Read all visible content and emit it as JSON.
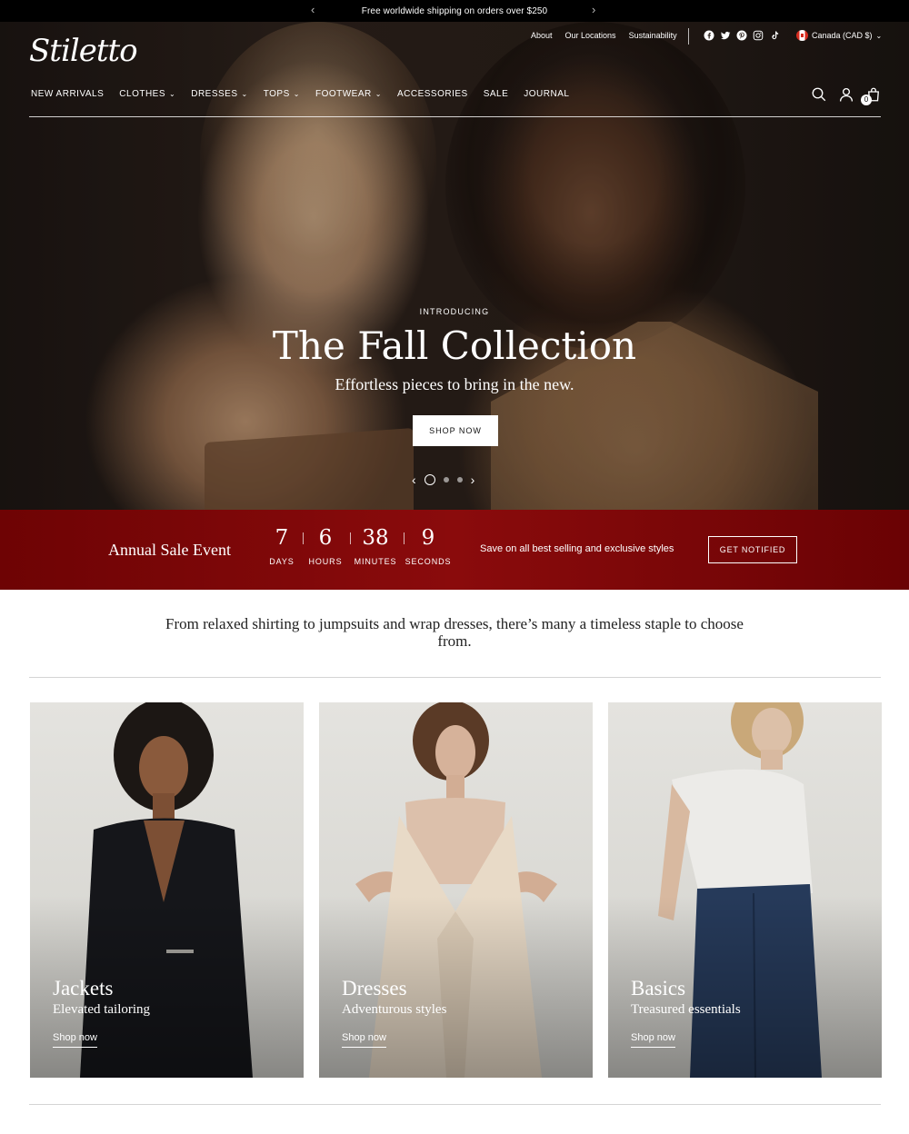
{
  "announcement": {
    "text": "Free worldwide shipping on orders over $250"
  },
  "brand": {
    "logo_text": "Stiletto"
  },
  "utility_nav": [
    "About",
    "Our Locations",
    "Sustainability"
  ],
  "social_icons": [
    "facebook-icon",
    "twitter-icon",
    "pinterest-icon",
    "instagram-icon",
    "tiktok-icon"
  ],
  "currency": {
    "label": "Canada (CAD $)"
  },
  "main_nav": [
    {
      "label": "NEW ARRIVALS",
      "dropdown": false
    },
    {
      "label": "CLOTHES",
      "dropdown": true
    },
    {
      "label": "DRESSES",
      "dropdown": true
    },
    {
      "label": "TOPS",
      "dropdown": true
    },
    {
      "label": "FOOTWEAR",
      "dropdown": true
    },
    {
      "label": "ACCESSORIES",
      "dropdown": false
    },
    {
      "label": "SALE",
      "dropdown": false
    },
    {
      "label": "JOURNAL",
      "dropdown": false
    }
  ],
  "header_icons": [
    "search-icon",
    "account-icon",
    "cart-icon"
  ],
  "cart": {
    "count": "0"
  },
  "hero": {
    "eyebrow": "INTRODUCING",
    "title": "The Fall Collection",
    "subtitle": "Effortless pieces to bring in the new.",
    "button": "SHOP NOW",
    "slides": 3,
    "active_slide": 1
  },
  "sale": {
    "title": "Annual Sale Event",
    "countdown": [
      {
        "value": "7",
        "label": "DAYS"
      },
      {
        "value": "6",
        "label": "HOURS"
      },
      {
        "value": "38",
        "label": "MINUTES"
      },
      {
        "value": "9",
        "label": "SECONDS"
      }
    ],
    "message": "Save on all best selling and exclusive styles",
    "button": "GET NOTIFIED"
  },
  "intro": {
    "text": "From relaxed shirting to jumpsuits and wrap dresses, there’s many a timeless staple to choose from."
  },
  "categories": [
    {
      "title": "Jackets",
      "subtitle": "Elevated tailoring",
      "link": "Shop now"
    },
    {
      "title": "Dresses",
      "subtitle": "Adventurous styles",
      "link": "Shop now"
    },
    {
      "title": "Basics",
      "subtitle": "Treasured essentials",
      "link": "Shop now"
    }
  ],
  "colors": {
    "sale_band": "#7c0506",
    "announcement_bg": "#000000",
    "text_dark": "#1a1a1a"
  }
}
